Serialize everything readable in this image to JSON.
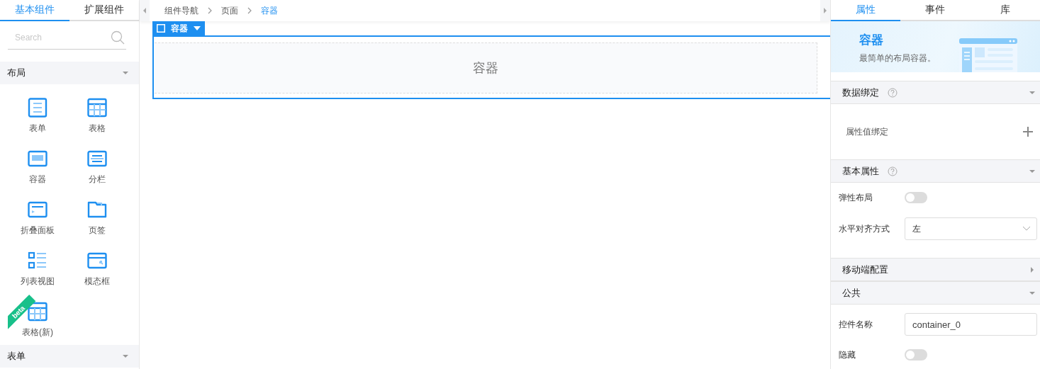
{
  "left_tabs": [
    {
      "label": "基本组件",
      "selected": true
    },
    {
      "label": "扩展组件",
      "selected": false
    }
  ],
  "search": {
    "placeholder": "Search"
  },
  "component_groups": [
    {
      "title": "布局",
      "items": [
        {
          "label": "表单",
          "kind": "form"
        },
        {
          "label": "表格",
          "kind": "table"
        },
        {
          "label": "容器",
          "kind": "container"
        },
        {
          "label": "分栏",
          "kind": "columns"
        },
        {
          "label": "折叠面板",
          "kind": "collapse"
        },
        {
          "label": "页签",
          "kind": "tabs"
        },
        {
          "label": "列表视图",
          "kind": "listview"
        },
        {
          "label": "模态框",
          "kind": "modal"
        },
        {
          "label": "表格(新)",
          "kind": "table",
          "badge": "beta"
        }
      ]
    },
    {
      "title": "表单"
    }
  ],
  "breadcrumb": [
    {
      "label": "组件导航",
      "current": false
    },
    {
      "label": "页面",
      "current": false
    },
    {
      "label": "容器",
      "current": true
    }
  ],
  "canvas": {
    "checked": false,
    "selected_tag": "容器",
    "container_label": "容器"
  },
  "right_tabs": [
    {
      "label": "属性",
      "selected": true
    },
    {
      "label": "事件",
      "selected": false
    },
    {
      "label": "库",
      "selected": false
    }
  ],
  "banner": {
    "title": "容器",
    "description": "最简单的布局容器。"
  },
  "sections": [
    {
      "title": "数据绑定",
      "help": true,
      "expanded": true,
      "rows": [
        {
          "kind": "binding",
          "label": "属性值绑定"
        }
      ]
    },
    {
      "title": "基本属性",
      "help": true,
      "expanded": true,
      "rows": [
        {
          "kind": "toggle",
          "label": "弹性布局",
          "on": false
        },
        {
          "kind": "select",
          "label": "水平对齐方式",
          "value": "左"
        }
      ]
    },
    {
      "title": "移动端配置",
      "help": false,
      "expanded": false
    },
    {
      "title": "公共",
      "help": false,
      "expanded": true,
      "rows": [
        {
          "kind": "input",
          "label": "控件名称",
          "value": "container_0"
        },
        {
          "kind": "toggle",
          "label": "隐藏",
          "on": false
        }
      ]
    }
  ]
}
